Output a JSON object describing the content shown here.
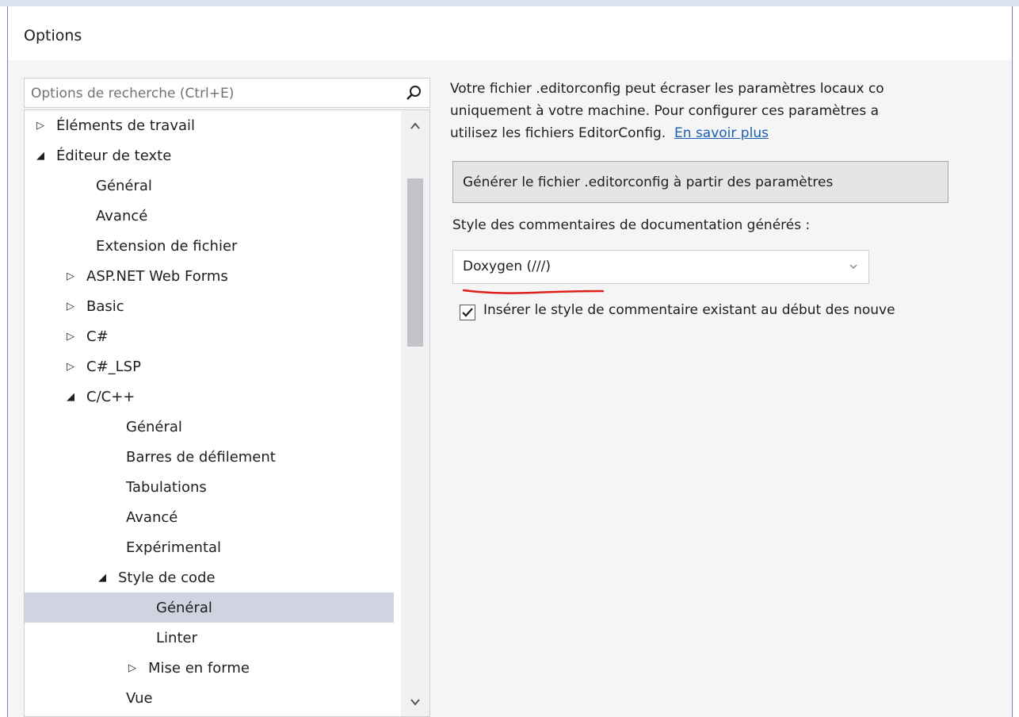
{
  "window": {
    "title": "Options"
  },
  "search": {
    "placeholder": "Options de recherche (Ctrl+E)"
  },
  "tree": {
    "items": [
      {
        "label": "Éléments de travail",
        "arrow": "▷",
        "selected": false
      },
      {
        "label": "Éditeur de texte",
        "arrow": "◢",
        "selected": false
      },
      {
        "label": "Général",
        "arrow": "",
        "selected": false
      },
      {
        "label": "Avancé",
        "arrow": "",
        "selected": false
      },
      {
        "label": "Extension de fichier",
        "arrow": "",
        "selected": false
      },
      {
        "label": "ASP.NET Web Forms",
        "arrow": "▷",
        "selected": false
      },
      {
        "label": "Basic",
        "arrow": "▷",
        "selected": false
      },
      {
        "label": "C#",
        "arrow": "▷",
        "selected": false
      },
      {
        "label": "C#_LSP",
        "arrow": "▷",
        "selected": false
      },
      {
        "label": "C/C++",
        "arrow": "◢",
        "selected": false
      },
      {
        "label": "Général",
        "arrow": "",
        "selected": false
      },
      {
        "label": "Barres de défilement",
        "arrow": "",
        "selected": false
      },
      {
        "label": "Tabulations",
        "arrow": "",
        "selected": false
      },
      {
        "label": "Avancé",
        "arrow": "",
        "selected": false
      },
      {
        "label": "Expérimental",
        "arrow": "",
        "selected": false
      },
      {
        "label": "Style de code",
        "arrow": "◢",
        "selected": false
      },
      {
        "label": "Général",
        "arrow": "",
        "selected": true
      },
      {
        "label": "Linter",
        "arrow": "",
        "selected": false
      },
      {
        "label": "Mise en forme",
        "arrow": "▷",
        "selected": false
      },
      {
        "label": "Vue",
        "arrow": "",
        "selected": false
      }
    ]
  },
  "panel": {
    "info_line1": "Votre fichier .editorconfig peut écraser les paramètres locaux co",
    "info_line2": "uniquement à votre machine. Pour configurer ces paramètres a",
    "info_line3": "utilisez les fichiers EditorConfig.",
    "learn_more": "En savoir plus",
    "generate_button": "Générer le fichier .editorconfig à partir des paramètres",
    "style_label": "Style des commentaires de documentation générés :",
    "style_value": "Doxygen (///)",
    "checkbox_checked": true,
    "checkbox_label": "Insérer le style de commentaire existant au début des nouve"
  },
  "colors": {
    "selection": "#cfd4e0",
    "link": "#1a5fb4",
    "annotation": "#e0201b",
    "window_border": "#6b87b0"
  }
}
